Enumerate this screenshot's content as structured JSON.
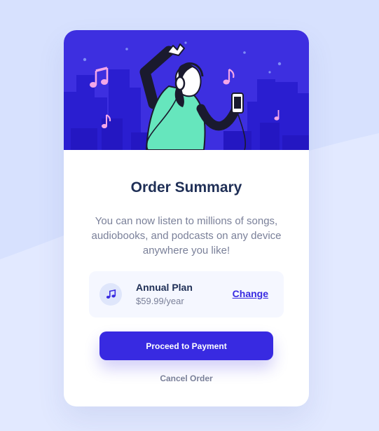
{
  "card": {
    "title": "Order Summary",
    "description": "You can now listen to millions of songs, audiobooks, and podcasts on any device anywhere you like!"
  },
  "plan": {
    "icon": "music-note-icon",
    "name": "Annual Plan",
    "price": "$59.99/year",
    "change_label": "Change"
  },
  "actions": {
    "proceed_label": "Proceed to Payment",
    "cancel_label": "Cancel Order"
  },
  "colors": {
    "page_background": "#d7e1fe",
    "primary": "#382ae1",
    "title": "#1f2f56",
    "muted_text": "#7a8099",
    "hero_accent": "#f3a6e8",
    "figure_shirt": "#66e6bd"
  }
}
